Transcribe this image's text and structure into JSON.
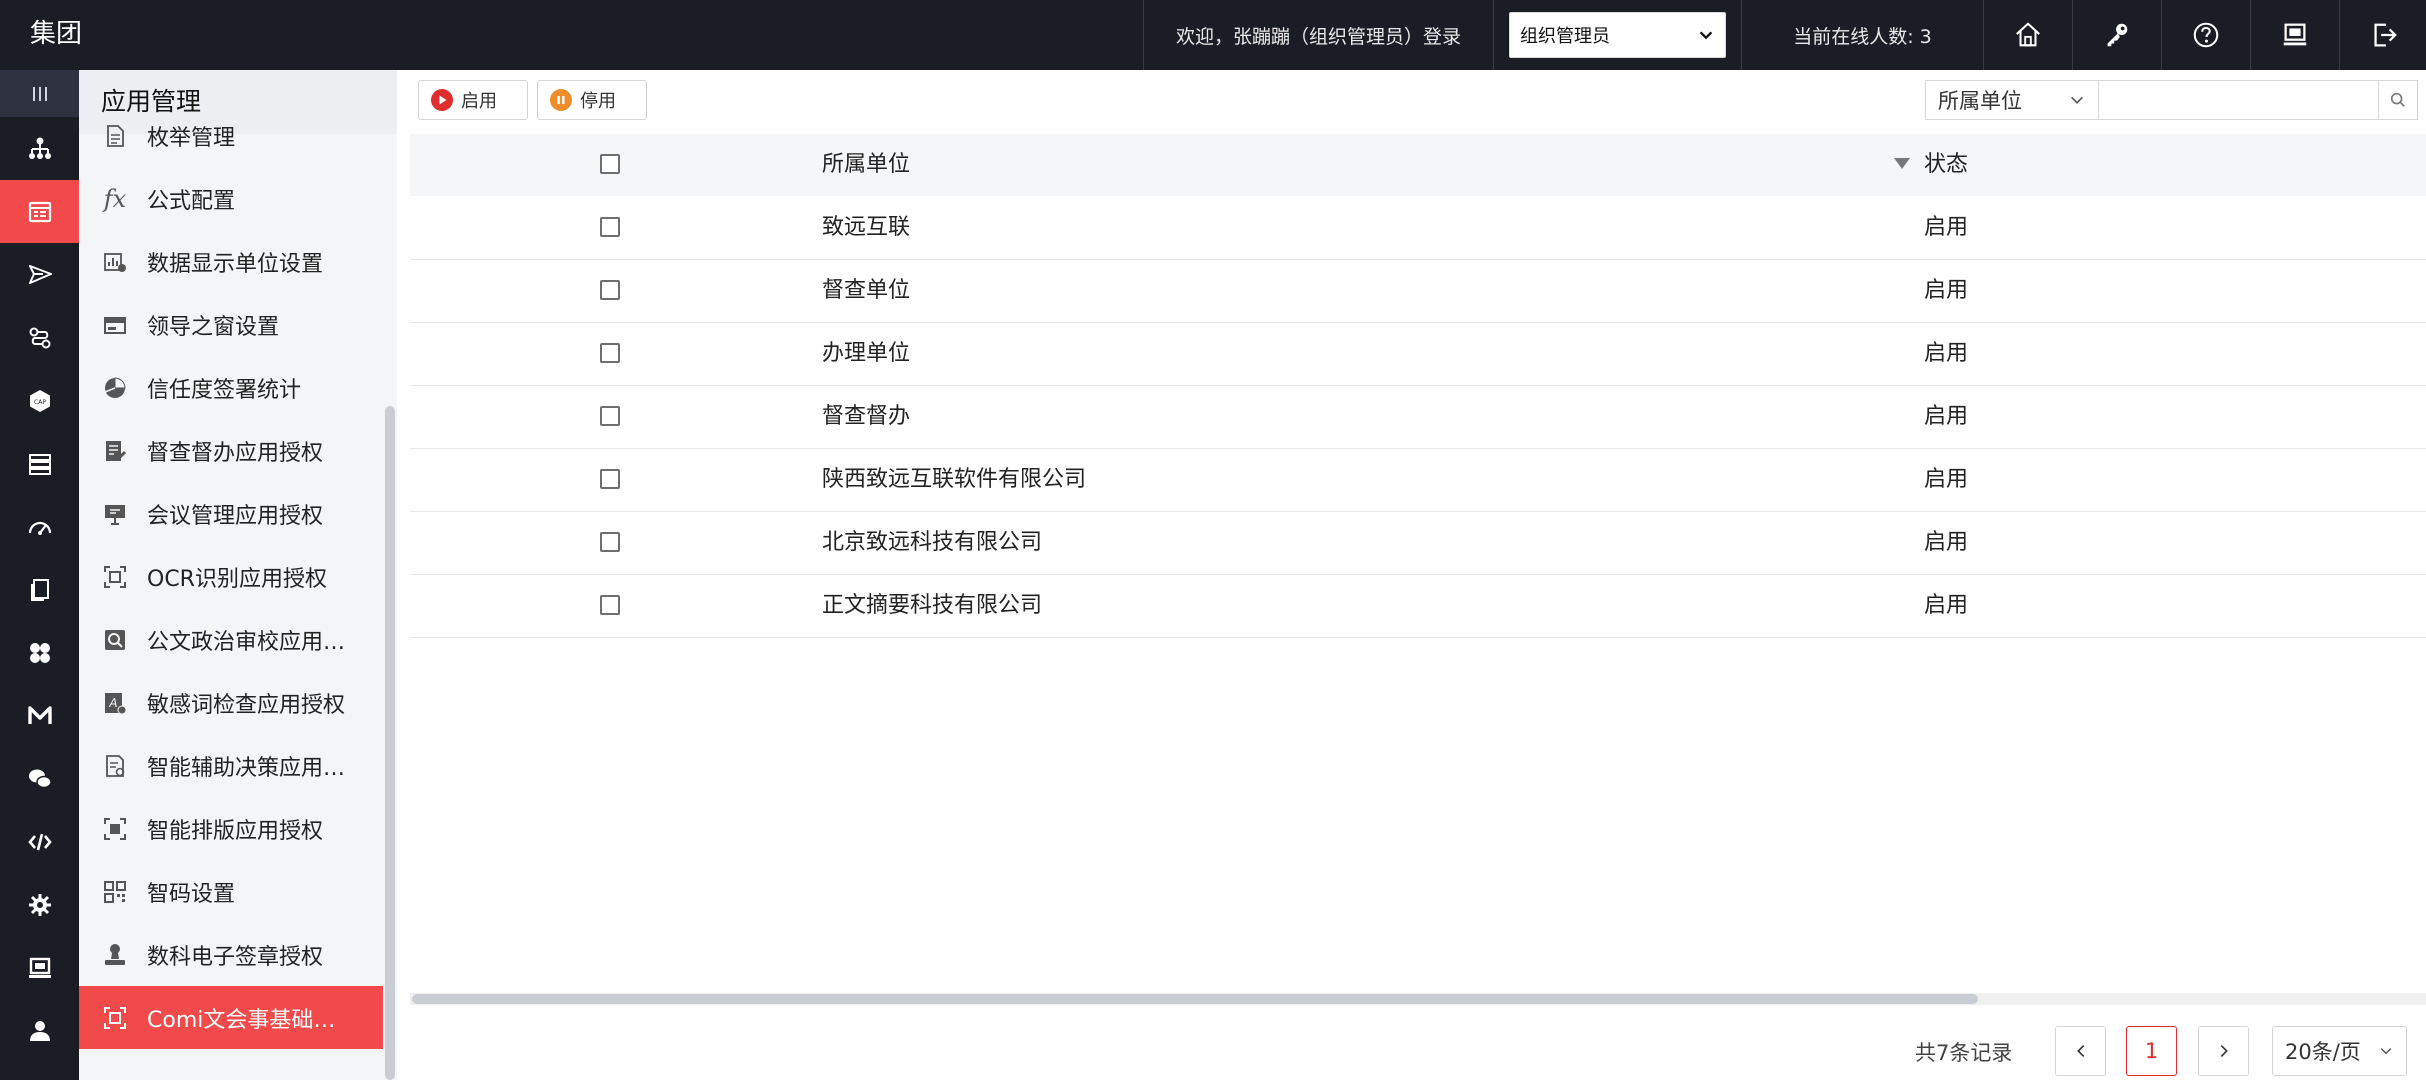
{
  "header": {
    "brand": "集团",
    "welcome": "欢迎，张蹦蹦（组织管理员）登录",
    "role_select": "组织管理员",
    "online": "当前在线人数: 3",
    "icons": [
      "home-icon",
      "key-icon",
      "help-icon",
      "monitor-icon",
      "logout-icon"
    ]
  },
  "rail": {
    "icons": [
      "menu-lines-icon",
      "org-chart-icon",
      "app-manage-icon",
      "send-icon",
      "flow-link-icon",
      "cap-icon",
      "layers-icon",
      "speedometer-icon",
      "document-copy-icon",
      "clover-icon",
      "m-letter-icon",
      "chat-icon",
      "code-icon",
      "gear-icon",
      "screen-icon",
      "user-icon"
    ],
    "active_index": 2
  },
  "submenu": {
    "title": "应用管理",
    "items": [
      {
        "label": "枚举管理",
        "icon": "document-icon"
      },
      {
        "label": "公式配置",
        "icon": "fx-icon"
      },
      {
        "label": "数据显示单位设置",
        "icon": "chart-settings-icon"
      },
      {
        "label": "领导之窗设置",
        "icon": "window-icon"
      },
      {
        "label": "信任度签署统计",
        "icon": "pie-chart-icon"
      },
      {
        "label": "督查督办应用授权",
        "icon": "doc-edit-icon"
      },
      {
        "label": "会议管理应用授权",
        "icon": "presentation-icon"
      },
      {
        "label": "OCR识别应用授权",
        "icon": "scan-icon"
      },
      {
        "label": "公文政治审校应用授权",
        "icon": "search-doc-icon"
      },
      {
        "label": "敏感词检查应用授权",
        "icon": "text-check-icon"
      },
      {
        "label": "智能辅助决策应用授权",
        "icon": "doc-assist-icon"
      },
      {
        "label": "智能排版应用授权",
        "icon": "scan-frame-icon"
      },
      {
        "label": "智码设置",
        "icon": "qr-code-icon"
      },
      {
        "label": "数科电子签章授权",
        "icon": "stamp-icon"
      },
      {
        "label": "Comi文会事基础授权",
        "icon": "scan-frame-icon"
      }
    ],
    "active_index": 14
  },
  "toolbar": {
    "enable_label": "启用",
    "disable_label": "停用",
    "filter_field": "所属单位",
    "search_value": ""
  },
  "table": {
    "columns": [
      "所属单位",
      "状态"
    ],
    "rows": [
      {
        "unit": "致远互联",
        "status": "启用"
      },
      {
        "unit": "督查单位",
        "status": "启用"
      },
      {
        "unit": "办理单位",
        "status": "启用"
      },
      {
        "unit": "督查督办",
        "status": "启用"
      },
      {
        "unit": "陕西致远互联软件有限公司",
        "status": "启用"
      },
      {
        "unit": "北京致远科技有限公司",
        "status": "启用"
      },
      {
        "unit": "正文摘要科技有限公司",
        "status": "启用"
      }
    ]
  },
  "pager": {
    "total": "共7条记录",
    "current_page": "1",
    "page_size": "20条/页"
  },
  "colors": {
    "topbar_bg": "#1b1d25",
    "accent_red": "#f24a4a",
    "submenu_bg": "#f4f5f7"
  }
}
